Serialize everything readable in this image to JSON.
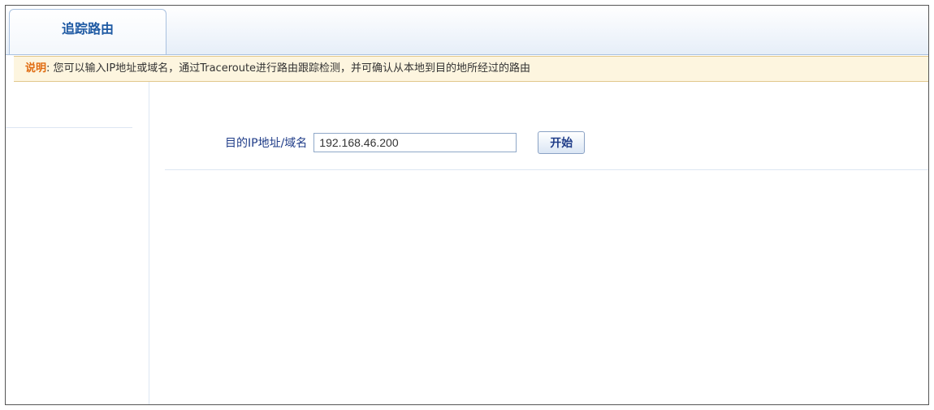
{
  "tab": {
    "label": "追踪路由"
  },
  "notice": {
    "key": "说明",
    "text": ": 您可以输入IP地址或域名，通过Traceroute进行路由跟踪检测，并可确认从本地到目的地所经过的路由"
  },
  "form": {
    "label": "目的IP地址/域名",
    "ip_value": "192.168.46.200",
    "start_label": "开始"
  }
}
